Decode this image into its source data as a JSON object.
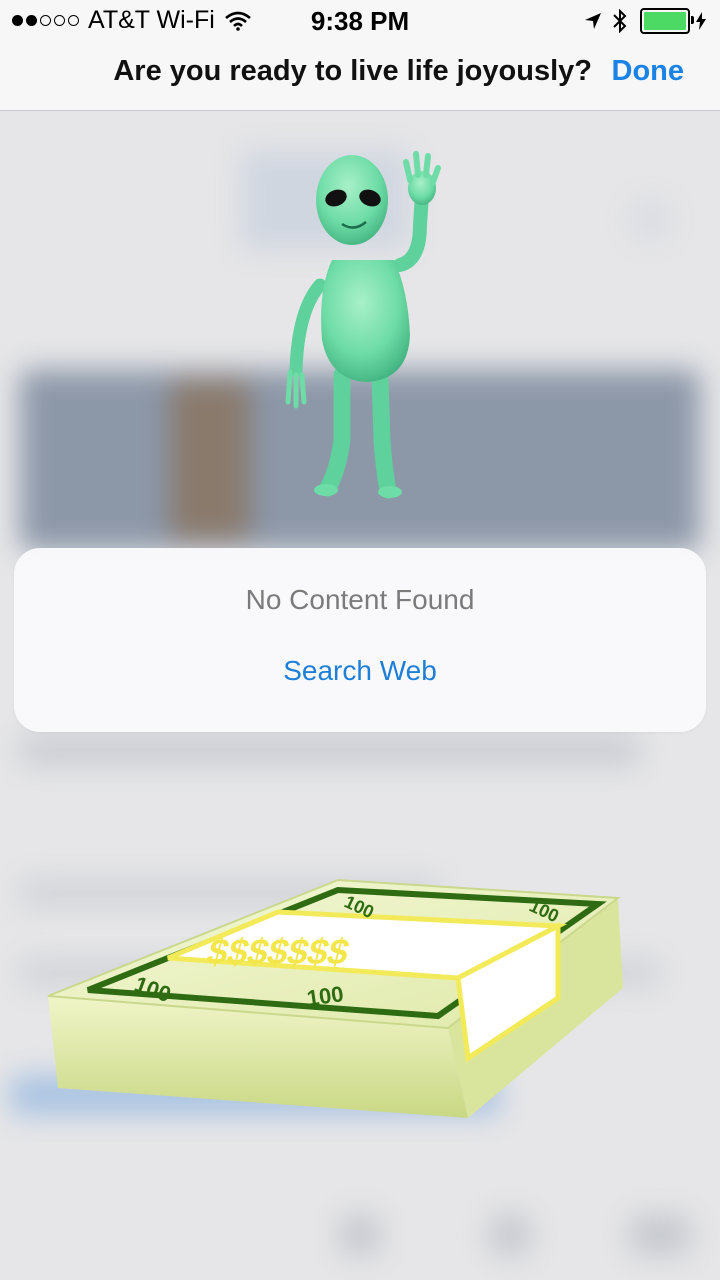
{
  "status_bar": {
    "signal_dots_filled": 2,
    "signal_dots_total": 5,
    "carrier": "AT&T Wi-Fi",
    "time": "9:38 PM",
    "icons": [
      "wifi-icon",
      "location-arrow-icon",
      "bluetooth-icon",
      "battery-charging-icon"
    ],
    "battery_level": 1.0,
    "battery_color": "#4cd964"
  },
  "nav": {
    "title": "Are you ready to live life joyously?",
    "done_label": "Done",
    "accent_color": "#1b82e6"
  },
  "card": {
    "message": "No Content Found",
    "search_label": "Search Web"
  },
  "stickers": {
    "alien": "alien-waving-sticker",
    "money": "money-stack-sticker"
  }
}
